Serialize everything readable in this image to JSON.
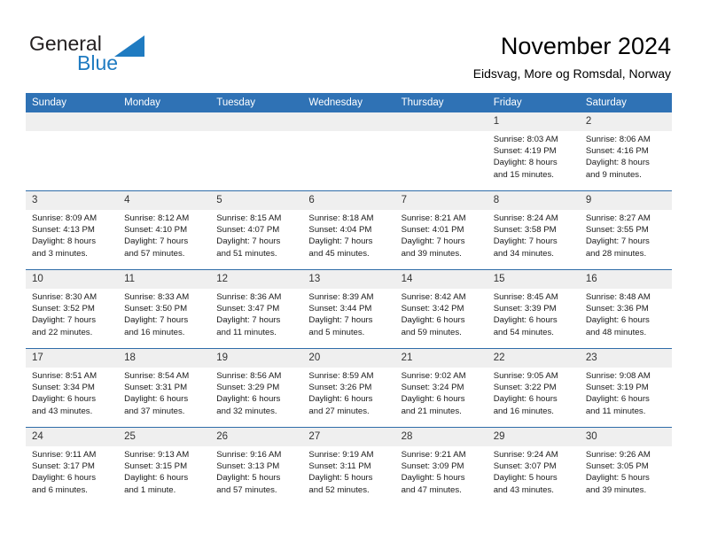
{
  "brand": {
    "name_part1": "General",
    "name_part2": "Blue",
    "logo_icon": "triangle-flag-icon",
    "accent_color": "#1f7bc1"
  },
  "header": {
    "title": "November 2024",
    "subtitle": "Eidsvag, More og Romsdal, Norway"
  },
  "theme": {
    "header_bg": "#2f72b5",
    "row_divider": "#2f6ca8",
    "daynum_bg": "#efefef"
  },
  "weekdays": [
    "Sunday",
    "Monday",
    "Tuesday",
    "Wednesday",
    "Thursday",
    "Friday",
    "Saturday"
  ],
  "weeks": [
    [
      {
        "day": "",
        "empty": true,
        "sunrise": "",
        "sunset": "",
        "daylight1": "",
        "daylight2": ""
      },
      {
        "day": "",
        "empty": true,
        "sunrise": "",
        "sunset": "",
        "daylight1": "",
        "daylight2": ""
      },
      {
        "day": "",
        "empty": true,
        "sunrise": "",
        "sunset": "",
        "daylight1": "",
        "daylight2": ""
      },
      {
        "day": "",
        "empty": true,
        "sunrise": "",
        "sunset": "",
        "daylight1": "",
        "daylight2": ""
      },
      {
        "day": "",
        "empty": true,
        "sunrise": "",
        "sunset": "",
        "daylight1": "",
        "daylight2": ""
      },
      {
        "day": "1",
        "sunrise": "Sunrise: 8:03 AM",
        "sunset": "Sunset: 4:19 PM",
        "daylight1": "Daylight: 8 hours",
        "daylight2": "and 15 minutes."
      },
      {
        "day": "2",
        "sunrise": "Sunrise: 8:06 AM",
        "sunset": "Sunset: 4:16 PM",
        "daylight1": "Daylight: 8 hours",
        "daylight2": "and 9 minutes."
      }
    ],
    [
      {
        "day": "3",
        "sunrise": "Sunrise: 8:09 AM",
        "sunset": "Sunset: 4:13 PM",
        "daylight1": "Daylight: 8 hours",
        "daylight2": "and 3 minutes."
      },
      {
        "day": "4",
        "sunrise": "Sunrise: 8:12 AM",
        "sunset": "Sunset: 4:10 PM",
        "daylight1": "Daylight: 7 hours",
        "daylight2": "and 57 minutes."
      },
      {
        "day": "5",
        "sunrise": "Sunrise: 8:15 AM",
        "sunset": "Sunset: 4:07 PM",
        "daylight1": "Daylight: 7 hours",
        "daylight2": "and 51 minutes."
      },
      {
        "day": "6",
        "sunrise": "Sunrise: 8:18 AM",
        "sunset": "Sunset: 4:04 PM",
        "daylight1": "Daylight: 7 hours",
        "daylight2": "and 45 minutes."
      },
      {
        "day": "7",
        "sunrise": "Sunrise: 8:21 AM",
        "sunset": "Sunset: 4:01 PM",
        "daylight1": "Daylight: 7 hours",
        "daylight2": "and 39 minutes."
      },
      {
        "day": "8",
        "sunrise": "Sunrise: 8:24 AM",
        "sunset": "Sunset: 3:58 PM",
        "daylight1": "Daylight: 7 hours",
        "daylight2": "and 34 minutes."
      },
      {
        "day": "9",
        "sunrise": "Sunrise: 8:27 AM",
        "sunset": "Sunset: 3:55 PM",
        "daylight1": "Daylight: 7 hours",
        "daylight2": "and 28 minutes."
      }
    ],
    [
      {
        "day": "10",
        "sunrise": "Sunrise: 8:30 AM",
        "sunset": "Sunset: 3:52 PM",
        "daylight1": "Daylight: 7 hours",
        "daylight2": "and 22 minutes."
      },
      {
        "day": "11",
        "sunrise": "Sunrise: 8:33 AM",
        "sunset": "Sunset: 3:50 PM",
        "daylight1": "Daylight: 7 hours",
        "daylight2": "and 16 minutes."
      },
      {
        "day": "12",
        "sunrise": "Sunrise: 8:36 AM",
        "sunset": "Sunset: 3:47 PM",
        "daylight1": "Daylight: 7 hours",
        "daylight2": "and 11 minutes."
      },
      {
        "day": "13",
        "sunrise": "Sunrise: 8:39 AM",
        "sunset": "Sunset: 3:44 PM",
        "daylight1": "Daylight: 7 hours",
        "daylight2": "and 5 minutes."
      },
      {
        "day": "14",
        "sunrise": "Sunrise: 8:42 AM",
        "sunset": "Sunset: 3:42 PM",
        "daylight1": "Daylight: 6 hours",
        "daylight2": "and 59 minutes."
      },
      {
        "day": "15",
        "sunrise": "Sunrise: 8:45 AM",
        "sunset": "Sunset: 3:39 PM",
        "daylight1": "Daylight: 6 hours",
        "daylight2": "and 54 minutes."
      },
      {
        "day": "16",
        "sunrise": "Sunrise: 8:48 AM",
        "sunset": "Sunset: 3:36 PM",
        "daylight1": "Daylight: 6 hours",
        "daylight2": "and 48 minutes."
      }
    ],
    [
      {
        "day": "17",
        "sunrise": "Sunrise: 8:51 AM",
        "sunset": "Sunset: 3:34 PM",
        "daylight1": "Daylight: 6 hours",
        "daylight2": "and 43 minutes."
      },
      {
        "day": "18",
        "sunrise": "Sunrise: 8:54 AM",
        "sunset": "Sunset: 3:31 PM",
        "daylight1": "Daylight: 6 hours",
        "daylight2": "and 37 minutes."
      },
      {
        "day": "19",
        "sunrise": "Sunrise: 8:56 AM",
        "sunset": "Sunset: 3:29 PM",
        "daylight1": "Daylight: 6 hours",
        "daylight2": "and 32 minutes."
      },
      {
        "day": "20",
        "sunrise": "Sunrise: 8:59 AM",
        "sunset": "Sunset: 3:26 PM",
        "daylight1": "Daylight: 6 hours",
        "daylight2": "and 27 minutes."
      },
      {
        "day": "21",
        "sunrise": "Sunrise: 9:02 AM",
        "sunset": "Sunset: 3:24 PM",
        "daylight1": "Daylight: 6 hours",
        "daylight2": "and 21 minutes."
      },
      {
        "day": "22",
        "sunrise": "Sunrise: 9:05 AM",
        "sunset": "Sunset: 3:22 PM",
        "daylight1": "Daylight: 6 hours",
        "daylight2": "and 16 minutes."
      },
      {
        "day": "23",
        "sunrise": "Sunrise: 9:08 AM",
        "sunset": "Sunset: 3:19 PM",
        "daylight1": "Daylight: 6 hours",
        "daylight2": "and 11 minutes."
      }
    ],
    [
      {
        "day": "24",
        "sunrise": "Sunrise: 9:11 AM",
        "sunset": "Sunset: 3:17 PM",
        "daylight1": "Daylight: 6 hours",
        "daylight2": "and 6 minutes."
      },
      {
        "day": "25",
        "sunrise": "Sunrise: 9:13 AM",
        "sunset": "Sunset: 3:15 PM",
        "daylight1": "Daylight: 6 hours",
        "daylight2": "and 1 minute."
      },
      {
        "day": "26",
        "sunrise": "Sunrise: 9:16 AM",
        "sunset": "Sunset: 3:13 PM",
        "daylight1": "Daylight: 5 hours",
        "daylight2": "and 57 minutes."
      },
      {
        "day": "27",
        "sunrise": "Sunrise: 9:19 AM",
        "sunset": "Sunset: 3:11 PM",
        "daylight1": "Daylight: 5 hours",
        "daylight2": "and 52 minutes."
      },
      {
        "day": "28",
        "sunrise": "Sunrise: 9:21 AM",
        "sunset": "Sunset: 3:09 PM",
        "daylight1": "Daylight: 5 hours",
        "daylight2": "and 47 minutes."
      },
      {
        "day": "29",
        "sunrise": "Sunrise: 9:24 AM",
        "sunset": "Sunset: 3:07 PM",
        "daylight1": "Daylight: 5 hours",
        "daylight2": "and 43 minutes."
      },
      {
        "day": "30",
        "sunrise": "Sunrise: 9:26 AM",
        "sunset": "Sunset: 3:05 PM",
        "daylight1": "Daylight: 5 hours",
        "daylight2": "and 39 minutes."
      }
    ]
  ]
}
